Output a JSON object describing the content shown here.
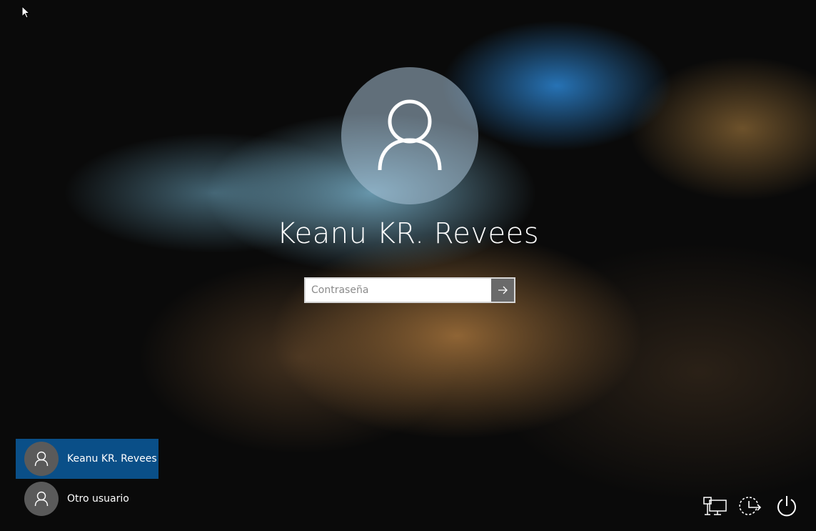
{
  "login": {
    "user_name": "Keanu KR. Revees",
    "password_placeholder": "Contraseña",
    "password_value": ""
  },
  "users": [
    {
      "name": "Keanu KR. Revees",
      "selected": true
    },
    {
      "name": "Otro usuario",
      "selected": false
    }
  ],
  "system_icons": [
    "network-icon",
    "ease-of-access-icon",
    "power-icon"
  ],
  "colors": {
    "selected_user": "#0a4f88",
    "avatar_large": "#aac3d7",
    "avatar_small": "#5a5a5a",
    "submit_button": "#6a6a6a"
  }
}
